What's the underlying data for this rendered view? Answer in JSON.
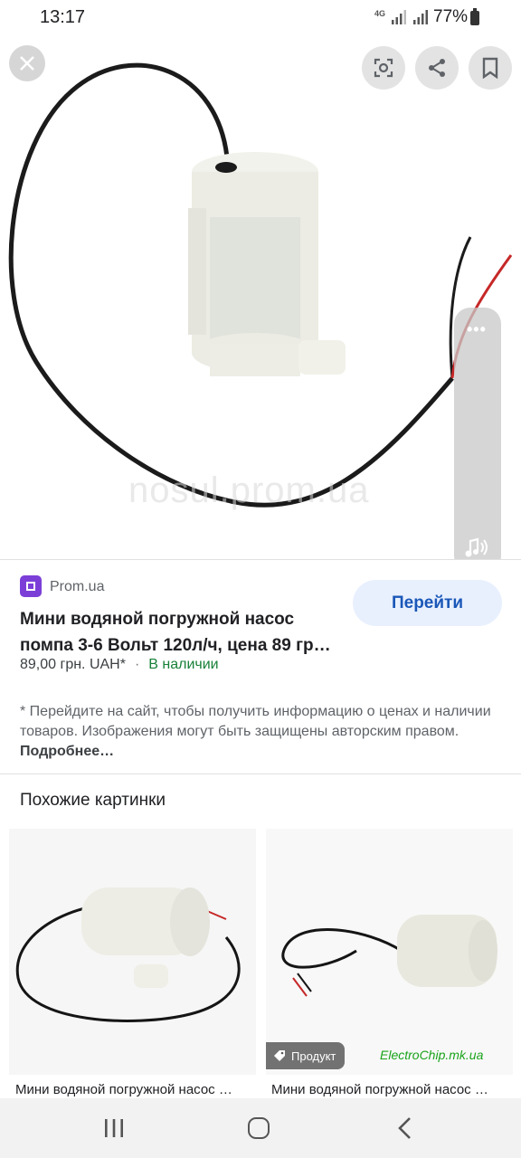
{
  "status_bar": {
    "time": "13:17",
    "network": "4G",
    "battery_percent": "77%"
  },
  "image_viewer": {
    "watermark": "nosul.prom.ua",
    "buttons": {
      "close": "close-icon",
      "lens": "lens-icon",
      "share": "share-icon",
      "save": "bookmark-icon"
    }
  },
  "result": {
    "site_name": "Prom.ua",
    "visit_button": "Перейти",
    "title": "Мини водяной погружной насос помпа 3-6 Вольт 120л/ч, цена 89 гр…",
    "price": "89,00 грн. UAH*",
    "separator": "·",
    "availability": "В наличии",
    "disclaimer": "* Перейдите на сайт, чтобы получить информацию о ценах и наличии товаров. Изображения могут быть защищены авторским правом.",
    "more_link": "Подробнее…"
  },
  "similar": {
    "heading": "Похожие картинки",
    "items": [
      {
        "title": "Мини водяной погружной насос …"
      },
      {
        "title": "Мини водяной погружной насос …",
        "chip": "Продукт",
        "brand": "ElectroChip.mk.ua"
      }
    ]
  },
  "colors": {
    "accent": "#1a57b8",
    "button_bg": "#e8f0fe",
    "in_stock": "#188038",
    "site_logo": "#7b3fd8"
  }
}
